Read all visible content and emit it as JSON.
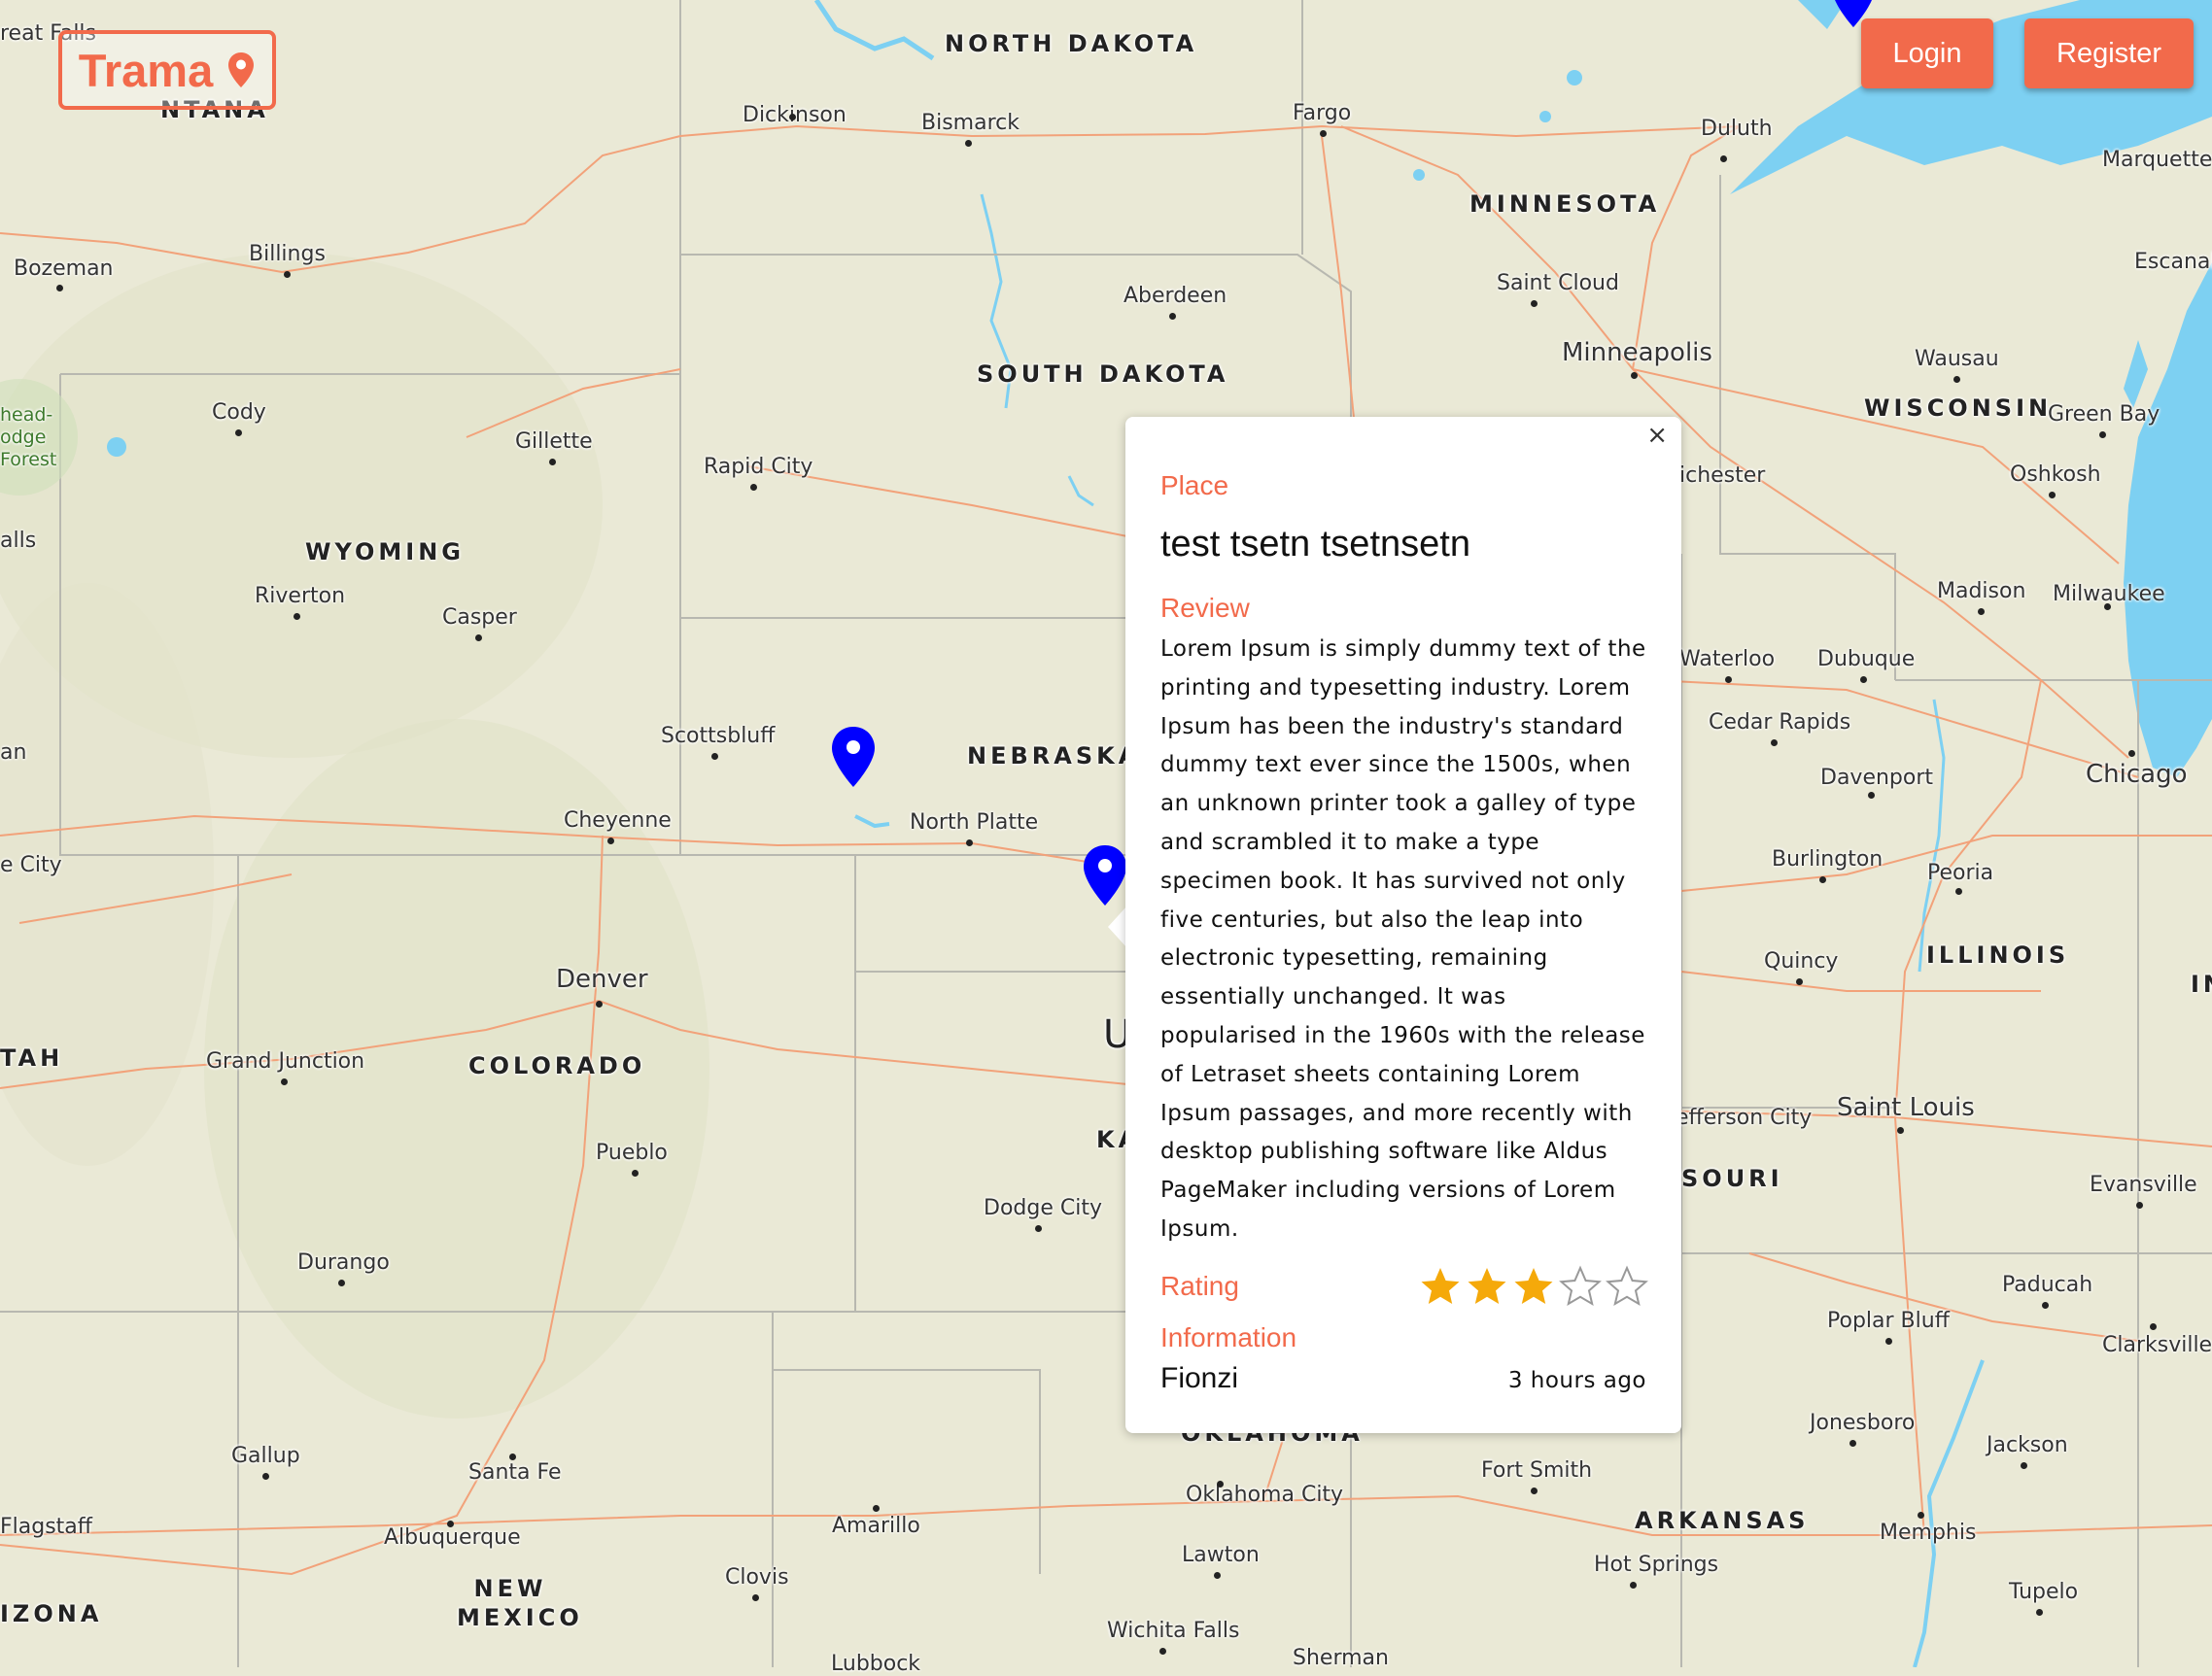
{
  "header": {
    "brand": "Trama",
    "login_label": "Login",
    "register_label": "Register"
  },
  "map": {
    "states": [
      "NORTH DAKOTA",
      "SOUTH DAKOTA",
      "MINNESOTA",
      "WISCONSIN",
      "WYOMING",
      "NEBRASKA",
      "COLORADO",
      "ILLINOIS",
      "ARKANSAS",
      "NEW MEXICO",
      "OKLAHOMA",
      "SOURI",
      "IZONA",
      "TAH",
      "KA",
      "U",
      "IN",
      "NTANA"
    ],
    "cities": [
      "Fargo",
      "Bismarck",
      "Dickinson",
      "Duluth",
      "Marquette",
      "Escanaba",
      "Billings",
      "Bozeman",
      "Aberdeen",
      "Saint Cloud",
      "Minneapolis",
      "Wausau",
      "Green Bay",
      "Oshkosh",
      "Cody",
      "Gillette",
      "Rapid City",
      "Riverton",
      "Casper",
      "Madison",
      "Milwaukee",
      "Waterloo",
      "Dubuque",
      "Cedar Rapids",
      "Scottsbluff",
      "Davenport",
      "Chicago",
      "North Platte",
      "Cheyenne",
      "Burlington",
      "Peoria",
      "Denver",
      "Quincy",
      "Grand Junction",
      "Saint Louis",
      "Pueblo",
      "Dodge City",
      "Evansville",
      "Durango",
      "Paducah",
      "Poplar Bluff",
      "Clarksville",
      "Gallup",
      "Santa Fe",
      "Jonesboro",
      "Jackson",
      "Fort Smith",
      "Oklahoma City",
      "Amarillo",
      "Albuquerque",
      "Lawton",
      "Hot Springs",
      "Memphis",
      "Clovis",
      "Tupelo",
      "Wichita Falls",
      "Sherman",
      "Lubbock",
      "Flagstaff",
      "ichester",
      "efferson City",
      "reat Falls",
      "an",
      "e City",
      "alls"
    ],
    "forest_label": "head-\nodge\nForest",
    "water_color": "#7dd0f2",
    "land_color": "#eae9d6",
    "road_color": "#f2a27a",
    "marker_color": "#0000ff"
  },
  "popup": {
    "close_label": "×",
    "place_heading": "Place",
    "place_name": "test tsetn tsetnsetn",
    "review_heading": "Review",
    "review_text": "Lorem Ipsum is simply dummy text of the printing and typesetting industry. Lorem Ipsum has been the industry's standard dummy text ever since the 1500s, when an unknown printer took a galley of type and scrambled it to make a type specimen book. It has survived not only five centuries, but also the leap into electronic typesetting, remaining essentially unchanged. It was popularised in the 1960s with the release of Letraset sheets containing Lorem Ipsum passages, and more recently with desktop publishing software like Aldus PageMaker including versions of Lorem Ipsum.",
    "rating_heading": "Rating",
    "rating": 3,
    "rating_max": 5,
    "info_heading": "Information",
    "author": "Fionzi",
    "time": "3 hours ago",
    "accent_color": "#f26a4b",
    "star_color": "#f5a90a"
  }
}
